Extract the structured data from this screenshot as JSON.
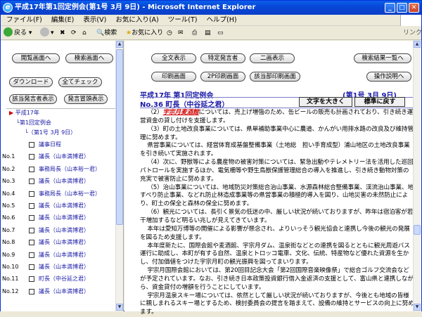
{
  "window": {
    "title": "平成17年第1回定例会(第1号 3月 9日) - Microsoft Internet Explorer"
  },
  "menu": [
    "ファイル(F)",
    "編集(E)",
    "表示(V)",
    "お気に入り(A)",
    "ツール(T)",
    "ヘルプ(H)"
  ],
  "toolbar": {
    "back": "戻る",
    "search": "検索",
    "favorites": "お気に入り",
    "links": "リンク"
  },
  "left": {
    "buttons": {
      "home": "閲覧画面へ",
      "search": "検索画面へ",
      "download": "ダウンロード",
      "check_all": "全てチェック",
      "show_speakers": "該当発言者表示",
      "show_headers": "発言冒頭表示"
    },
    "tree": {
      "year": "平成17年",
      "session": "第1回定例会",
      "meeting": "（第1号 3月 9日）"
    },
    "items": [
      {
        "no": "",
        "label": "議事日程"
      },
      {
        "no": "No.1",
        "label": "議長（山本満博君）"
      },
      {
        "no": "No.2",
        "label": "事務局長（山本裕一君）"
      },
      {
        "no": "No.3",
        "label": "議長（山本満博君）"
      },
      {
        "no": "No.4",
        "label": "事務局長（山本裕一君）"
      },
      {
        "no": "No.5",
        "label": "議長（山本満博君）"
      },
      {
        "no": "No.6",
        "label": "議長（山本満博君）"
      },
      {
        "no": "No.7",
        "label": "議長（山本満博君）"
      },
      {
        "no": "No.8",
        "label": "議長（山本満博君）"
      },
      {
        "no": "No.9",
        "label": "議長（山本満博君）"
      },
      {
        "no": "No.10",
        "label": "議長（山本満博君）"
      },
      {
        "no": "No.11",
        "label": "町長（中谷延之君）"
      },
      {
        "no": "No.12",
        "label": "議長（山本満博君）"
      }
    ]
  },
  "right": {
    "buttons": {
      "show_all": "全文表示",
      "specific_speaker": "特定発言者",
      "two_panel": "二画表示",
      "result_list": "検索結果一覧へ",
      "print": "印刷画面",
      "print_2p": "2P印刷画面",
      "print_speaker": "該当部印刷画面",
      "help": "操作説明へ"
    },
    "session": "平成17年 第1回定例会",
    "date": "(第1号 3月 9日)",
    "speaker": "No.36 町長（中谷延之君）",
    "text_size": "文字を大きく",
    "reset": "標準に戻す",
    "keyword": "宇宗月麦酒館",
    "paragraphs": [
      "（2）|KW|については、売上げ増強のため、缶ビールの販売も計画されており、引き続き運営資金の貸し付けを支援します。",
      "（3）町の土地改良事業については、県単補助事業中心に農道、かんがい用排水路の改良及び維持管理に努めます。",
      "県営事業については、経営体育成基盤整備事業（土地総　担い手育成型）浦山地区の土地改良事業を引き続いて実施されます。",
      "（4）次に、野獣等による農産物の被害対策については、緊急出動やテレメトリー法を活用した巡回パトロールを実施するほか、電気柵等や野生鳥獣保護管理総合の導入を推進し、引き続き動物対策の充実で被害防止に努めます。",
      "（5）治山事業については、地域防災対策総合治山事業、水源森林総合整備事業、渓流治山事業、地すべり防止事業、などれ防止林造成事業等の県営事業の積極的導入を図り、山地災害の未然防止により、町土の保全と森林の保全に努めます。",
      "（6）観光については、長引く景気の低迷の中、厳しい状況が続いておりますが、昨年は宿泊客が若干増加するなど明るい兆しが見えてきています。",
      "本年は愛知万博等の開催による影響が懸念され、よりいっそう観光協会と連携し今後の観光の発展を図るため支援します。",
      "本年度新たに、国際会館や麦酒館、宇宗月ダム、温泉街などとの連携を図るとともに観光周遊バス運行に助成し、本町が有する自然、温泉とトロッコ電車、文化、伝統、特産物など優れた資源を生かし、付加価値をつけた宇宗月町の観光振興を図ってまいります。",
      "宇宗月国際会館においては、第20回目記念大会「第2回国際音楽映像祭」で総合ゴルフ交流会などが予定されています。なお、引き続き日本政策投資銀行借入金返済の支援として、富山県と連携しながら、資金貸付の増額を行うことにしています。",
      "宇宗月温泉スキー場については、依然として厳しい状況が続いておりますが、今後とも地域の皆様に親しまれるスキー場とするため、検討委員会の提言を踏まえて、設備の維持とサービスの向上に努めます。"
    ]
  }
}
